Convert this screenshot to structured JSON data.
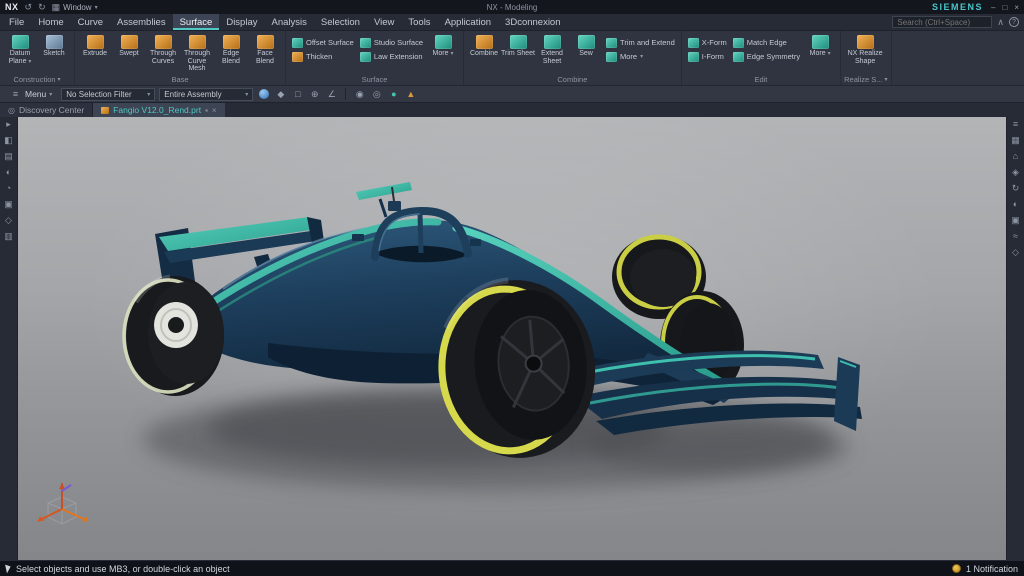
{
  "titlebar": {
    "app": "NX",
    "title": "NX - Modeling",
    "brand": "SIEMENS",
    "window_label": "Window"
  },
  "menubar": {
    "items": [
      {
        "label": "File"
      },
      {
        "label": "Home"
      },
      {
        "label": "Curve"
      },
      {
        "label": "Assemblies"
      },
      {
        "label": "Surface"
      },
      {
        "label": "Display"
      },
      {
        "label": "Analysis"
      },
      {
        "label": "Selection"
      },
      {
        "label": "View"
      },
      {
        "label": "Tools"
      },
      {
        "label": "Application"
      },
      {
        "label": "3Dconnexion"
      }
    ],
    "active_item": "Surface",
    "search_placeholder": "Search (Ctrl+Space)"
  },
  "ribbon": {
    "groups": [
      {
        "label": "Construction",
        "tools": [
          {
            "label": "Datum Plane"
          },
          {
            "label": "Sketch"
          }
        ]
      },
      {
        "label": "Base",
        "tools": [
          {
            "label": "Extrude"
          },
          {
            "label": "Swept"
          },
          {
            "label": "Through Curves"
          },
          {
            "label": "Through Curve Mesh"
          },
          {
            "label": "Edge Blend"
          },
          {
            "label": "Face Blend"
          }
        ]
      },
      {
        "label": "Surface",
        "tools": [
          {
            "label": "Offset Surface"
          },
          {
            "label": "Studio Surface"
          },
          {
            "label": "Thicken"
          },
          {
            "label": "Law Extension"
          },
          {
            "label": "More"
          }
        ]
      },
      {
        "label": "Combine",
        "tools": [
          {
            "label": "Combine"
          },
          {
            "label": "Trim Sheet"
          },
          {
            "label": "Extend Sheet"
          },
          {
            "label": "Sew"
          },
          {
            "label": "Trim and Extend"
          },
          {
            "label": "More"
          }
        ]
      },
      {
        "label": "Edit",
        "tools": [
          {
            "label": "X-Form"
          },
          {
            "label": "I-Form"
          },
          {
            "label": "Match Edge"
          },
          {
            "label": "Edge Symmetry"
          },
          {
            "label": "More"
          }
        ]
      },
      {
        "label": "Realize S...",
        "tools": [
          {
            "label": "NX Realize Shape"
          }
        ]
      }
    ]
  },
  "toolbar": {
    "menu_label": "Menu",
    "selection_filter": "No Selection Filter",
    "scope": "Entire Assembly"
  },
  "tabbar": {
    "tabs": [
      {
        "label": "Discovery Center"
      },
      {
        "label": "Fangio V12.0_Rend.prt"
      }
    ]
  },
  "statusbar": {
    "message": "Select objects and use MB3, or double-click an object",
    "notification": "1 Notification"
  },
  "colors": {
    "accent_teal": "#45c4b2",
    "car_body_navy": "#1d3c58",
    "tire_stripe_yellow": "#d4d74a",
    "viewport_top_gray": "#b2b4b6",
    "viewport_bottom_gray": "#84868a"
  }
}
